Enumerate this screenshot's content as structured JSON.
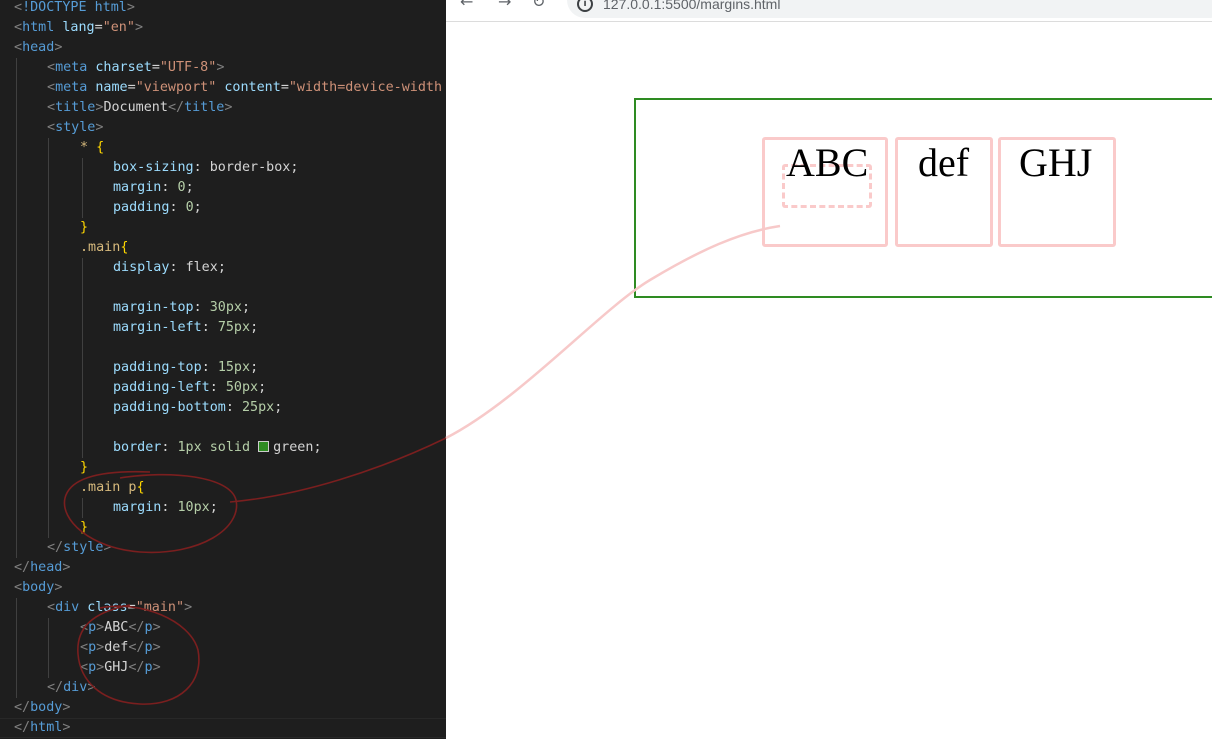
{
  "editor": {
    "lines": [
      [
        "<",
        "!DOCTYPE ",
        "html",
        ">"
      ],
      [
        "<",
        "html",
        " lang",
        "=",
        "\"en\"",
        ">"
      ],
      [
        "<",
        "head",
        ">"
      ],
      [
        "<",
        "meta",
        " charset",
        "=",
        "\"UTF-8\"",
        ">"
      ],
      [
        "<",
        "meta",
        " name",
        "=",
        "\"viewport\"",
        " content",
        "=",
        "\"width=device-width"
      ],
      [
        "<",
        "title",
        ">",
        "Document",
        "</",
        "title",
        ">"
      ],
      [
        "<",
        "style",
        ">"
      ],
      [
        "* ",
        "{"
      ],
      [
        "box-sizing",
        ": ",
        "border-box",
        ";"
      ],
      [
        "margin",
        ": ",
        "0",
        ";"
      ],
      [
        "padding",
        ": ",
        "0",
        ";"
      ],
      [
        "}"
      ],
      [
        ".main",
        "{"
      ],
      [
        "display",
        ": ",
        "flex",
        ";"
      ],
      [
        ""
      ],
      [
        "margin-top",
        ": ",
        "30px",
        ";"
      ],
      [
        "margin-left",
        ": ",
        "75px",
        ";"
      ],
      [
        ""
      ],
      [
        "padding-top",
        ": ",
        "15px",
        ";"
      ],
      [
        "padding-left",
        ": ",
        "50px",
        ";"
      ],
      [
        "padding-bottom",
        ": ",
        "25px",
        ";"
      ],
      [
        ""
      ],
      [
        "border",
        ": ",
        "1px solid ",
        "",
        "green",
        ";"
      ],
      [
        "}"
      ],
      [
        ".main p",
        "{"
      ],
      [
        "margin",
        ": ",
        "10px",
        ";"
      ],
      [
        "}"
      ],
      [
        "</",
        "style",
        ">"
      ],
      [
        "</",
        "head",
        ">"
      ],
      [
        "<",
        "body",
        ">"
      ],
      [
        "<",
        "div",
        " class",
        "=",
        "\"main\"",
        ">"
      ],
      [
        "<",
        "p",
        ">",
        "ABC",
        "</",
        "p",
        ">"
      ],
      [
        "<",
        "p",
        ">",
        "def",
        "</",
        "p",
        ">"
      ],
      [
        "<",
        "p",
        ">",
        "GHJ",
        "</",
        "p",
        ">"
      ],
      [
        "</",
        "div",
        ">"
      ],
      [
        "</",
        "body",
        ">"
      ],
      [
        "</",
        "html",
        ">"
      ]
    ]
  },
  "browser": {
    "back_icon": "back-arrow-icon",
    "forward_icon": "forward-arrow-icon",
    "reload_icon": "reload-icon",
    "url": "127.0.0.1:5500/margins.html",
    "border_color": "#2e8b22",
    "paragraphs": [
      "ABC",
      "def",
      "GHJ"
    ]
  },
  "annotation_color": "#7a1f1f"
}
